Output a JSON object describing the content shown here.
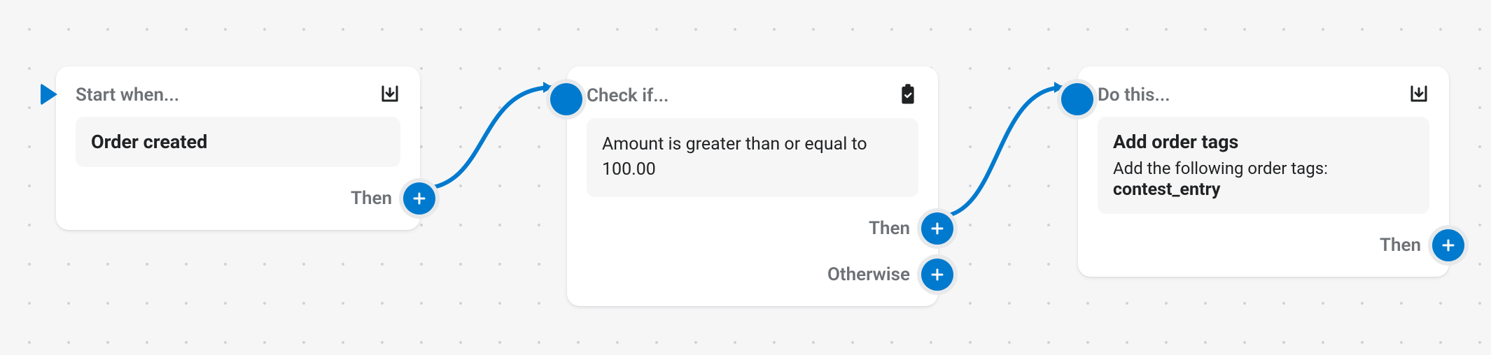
{
  "colors": {
    "accent": "#007ace",
    "muted": "#6d7175",
    "text": "#202223",
    "bg": "#f6f6f7"
  },
  "cards": {
    "start": {
      "title": "Start when...",
      "icon": "download-icon",
      "content_strong": "Order created",
      "ports": {
        "then": "Then"
      }
    },
    "check": {
      "title": "Check if...",
      "icon": "clipboard-check-icon",
      "content_text": "Amount is greater than or equal to 100.00",
      "ports": {
        "then": "Then",
        "otherwise": "Otherwise"
      }
    },
    "action": {
      "title": "Do this...",
      "icon": "download-icon",
      "content_strong": "Add order tags",
      "content_sub": "Add the following order tags:",
      "content_tag": "contest_entry",
      "ports": {
        "then": "Then"
      }
    }
  }
}
